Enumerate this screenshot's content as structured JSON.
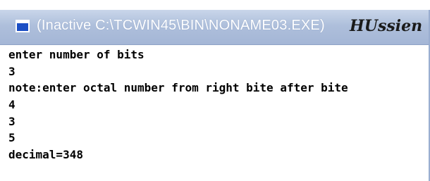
{
  "window": {
    "title": "(Inactive C:\\TCWIN45\\BIN\\NONAME03.EXE)",
    "signature": "HUssien",
    "icon": "window-app-icon"
  },
  "console": {
    "lines": [
      "enter number of bits",
      "3",
      "note:enter octal number from right bite after bite",
      "4",
      "3",
      "5",
      "decimal=348"
    ]
  },
  "colors": {
    "titlebar": "#aebfdb",
    "title_text": "#ffffff",
    "console_bg": "#ffffff",
    "console_text": "#000000"
  }
}
